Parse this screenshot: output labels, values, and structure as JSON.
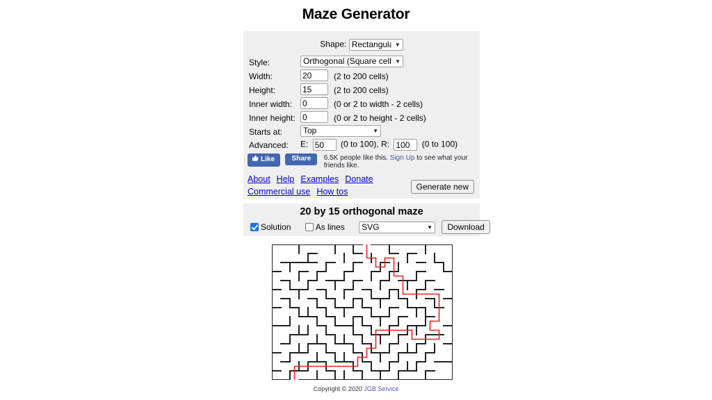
{
  "page": {
    "title": "Maze Generator"
  },
  "form": {
    "shape": {
      "label": "Shape:",
      "value": "Rectangular"
    },
    "style": {
      "label": "Style:",
      "value": "Orthogonal (Square cells)"
    },
    "width": {
      "label": "Width:",
      "value": "20",
      "hint": "(2 to 200 cells)"
    },
    "height": {
      "label": "Height:",
      "value": "15",
      "hint": "(2 to 200 cells)"
    },
    "inner_width": {
      "label": "Inner width:",
      "value": "0",
      "hint": "(0 or 2 to width - 2 cells)"
    },
    "inner_height": {
      "label": "Inner height:",
      "value": "0",
      "hint": "(0 or 2 to height - 2 cells)"
    },
    "starts_at": {
      "label": "Starts at:",
      "value": "Top"
    },
    "advanced": {
      "label": "Advanced:",
      "e_label": "E:",
      "e_value": "50",
      "e_hint": "(0 to 100), R:",
      "r_value": "100",
      "r_hint": "(0 to 100)"
    },
    "generate_button": "Generate new"
  },
  "social": {
    "like_label": "Like",
    "share_label": "Share",
    "count_text": "6.5K people like this.",
    "signup_link": "Sign Up",
    "tail_text": " to see what your friends like."
  },
  "links": [
    {
      "label": "About"
    },
    {
      "label": "Help"
    },
    {
      "label": "Examples"
    },
    {
      "label": "Donate"
    },
    {
      "label": "Commercial use"
    },
    {
      "label": "How tos"
    }
  ],
  "output": {
    "heading": "20 by 15 orthogonal maze",
    "solution_label": "Solution",
    "solution_checked": true,
    "as_lines_label": "As lines",
    "as_lines_checked": false,
    "format_value": "SVG",
    "download_button": "Download"
  },
  "footer": {
    "copyright": "Copyright © 2020 ",
    "link": "JGB Service"
  },
  "colors": {
    "panel_bg": "#efefef",
    "link": "#0000cc",
    "facebook_blue": "#4267B2",
    "checkbox_accent": "#1a73e8",
    "maze_wall": "#222222",
    "maze_solution": "#ee2222"
  },
  "maze": {
    "cols": 20,
    "rows": 15,
    "cell": 13,
    "entry_col": 10,
    "exit_col": 2,
    "h_walls": [
      "11111111111111111111",
      "00001000010001010000",
      "01111010010010001010",
      "10010100100101001001",
      "01001011010010110100",
      "10110100101001001010",
      "01001010010110100101",
      "10100101101001011010",
      "00011010010110100100",
      "11000101101001011001",
      "00110010010110100110",
      "01001101101001001001",
      "10110010010110110100",
      "01001101101001001011",
      "10110010010110110100",
      "11111111111111111111"
    ],
    "v_walls": [
      "100100010100010001001",
      "100010001001000100101",
      "101000100100101000011",
      "100101001001010010001",
      "101010010100100101001",
      "100100101001011010001",
      "101001010110100100101",
      "100110101001010011001",
      "101001010110101001001",
      "100110100101010110001",
      "101001011010101001001",
      "100110100101010110101",
      "101001011010101001001",
      "100110100101010110001",
      "101001011010101001001"
    ],
    "solution_path": [
      [
        10,
        -1
      ],
      [
        10,
        0
      ],
      [
        10,
        1
      ],
      [
        11,
        1
      ],
      [
        11,
        2
      ],
      [
        12,
        2
      ],
      [
        12,
        1
      ],
      [
        13,
        1
      ],
      [
        13,
        2
      ],
      [
        13,
        3
      ],
      [
        14,
        3
      ],
      [
        14,
        4
      ],
      [
        14,
        5
      ],
      [
        15,
        5
      ],
      [
        16,
        5
      ],
      [
        17,
        5
      ],
      [
        18,
        5
      ],
      [
        18,
        6
      ],
      [
        18,
        7
      ],
      [
        18,
        8
      ],
      [
        17,
        8
      ],
      [
        17,
        9
      ],
      [
        18,
        9
      ],
      [
        18,
        10
      ],
      [
        17,
        10
      ],
      [
        16,
        10
      ],
      [
        15,
        10
      ],
      [
        15,
        9
      ],
      [
        14,
        9
      ],
      [
        13,
        9
      ],
      [
        12,
        9
      ],
      [
        11,
        9
      ],
      [
        11,
        10
      ],
      [
        11,
        11
      ],
      [
        10,
        11
      ],
      [
        10,
        12
      ],
      [
        9,
        12
      ],
      [
        9,
        13
      ],
      [
        8,
        13
      ],
      [
        7,
        13
      ],
      [
        6,
        13
      ],
      [
        5,
        13
      ],
      [
        4,
        13
      ],
      [
        3,
        13
      ],
      [
        2,
        13
      ],
      [
        2,
        14
      ],
      [
        2,
        15
      ]
    ]
  }
}
